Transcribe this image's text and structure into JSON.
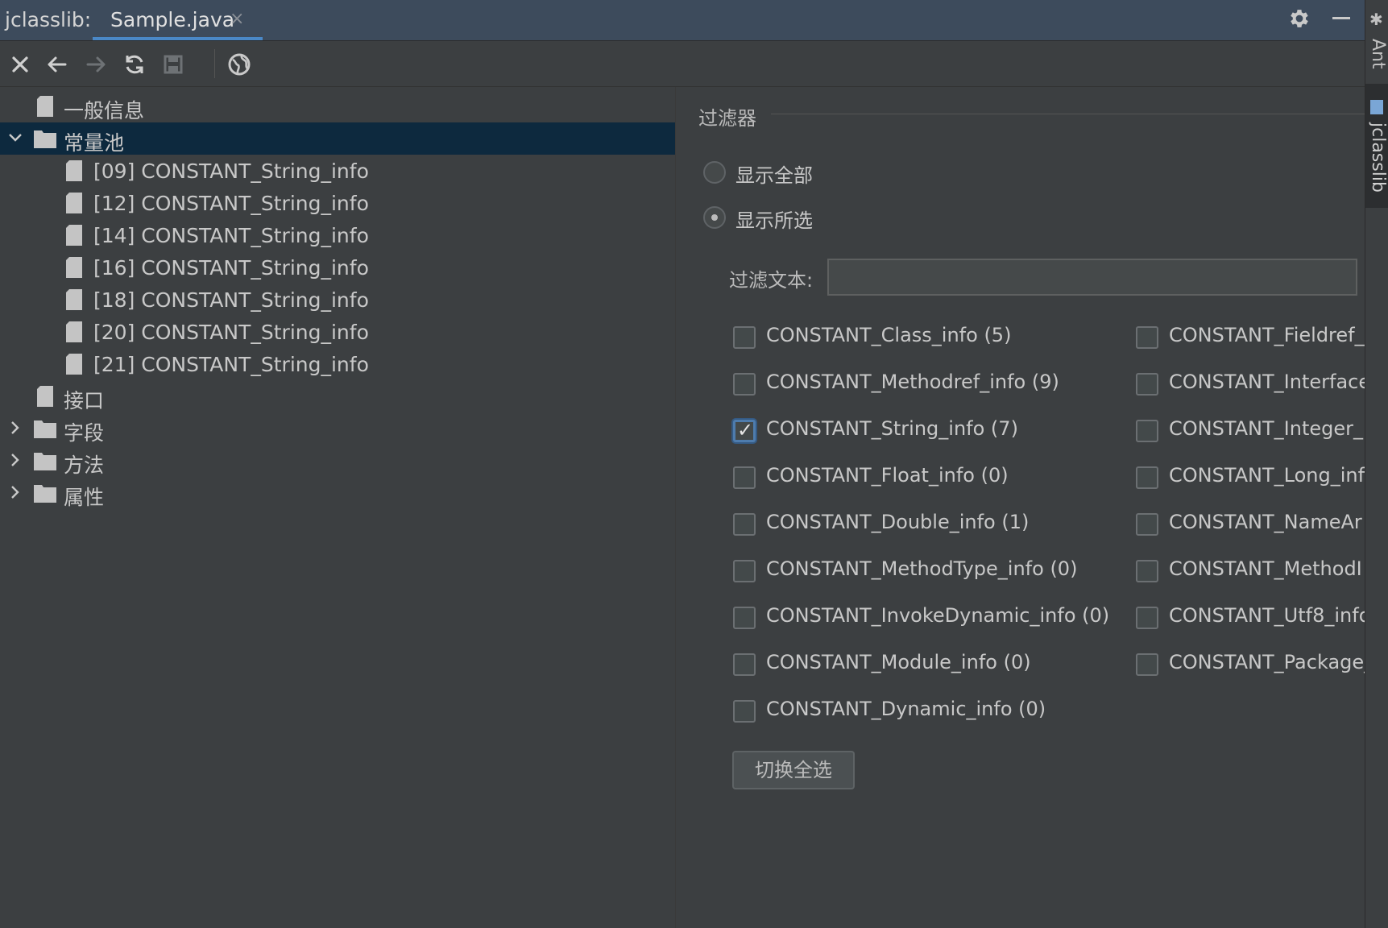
{
  "app": {
    "title": "jclasslib:"
  },
  "tab": {
    "label": "Sample.java",
    "close": "×"
  },
  "tree": {
    "items": [
      {
        "label": "一般信息",
        "type": "file",
        "level": 0,
        "expand": "none"
      },
      {
        "label": "常量池",
        "type": "folder",
        "level": 0,
        "expand": "expanded",
        "selected": true
      },
      {
        "label": "[09] CONSTANT_String_info",
        "type": "file",
        "level": 1
      },
      {
        "label": "[12] CONSTANT_String_info",
        "type": "file",
        "level": 1
      },
      {
        "label": "[14] CONSTANT_String_info",
        "type": "file",
        "level": 1
      },
      {
        "label": "[16] CONSTANT_String_info",
        "type": "file",
        "level": 1
      },
      {
        "label": "[18] CONSTANT_String_info",
        "type": "file",
        "level": 1
      },
      {
        "label": "[20] CONSTANT_String_info",
        "type": "file",
        "level": 1
      },
      {
        "label": "[21] CONSTANT_String_info",
        "type": "file",
        "level": 1
      },
      {
        "label": "接口",
        "type": "file",
        "level": 0,
        "expand": "none"
      },
      {
        "label": "字段",
        "type": "folder",
        "level": 0,
        "expand": "collapsed"
      },
      {
        "label": "方法",
        "type": "folder",
        "level": 0,
        "expand": "collapsed"
      },
      {
        "label": "属性",
        "type": "folder",
        "level": 0,
        "expand": "collapsed"
      }
    ]
  },
  "filter": {
    "title": "过滤器",
    "radio_all": "显示全部",
    "radio_selected": "显示所选",
    "selected_radio": "radio_selected",
    "text_label": "过滤文本:",
    "text_value": "",
    "col1": [
      {
        "label": "CONSTANT_Class_info (5)",
        "checked": false
      },
      {
        "label": "CONSTANT_Methodref_info (9)",
        "checked": false
      },
      {
        "label": "CONSTANT_String_info (7)",
        "checked": true
      },
      {
        "label": "CONSTANT_Float_info (0)",
        "checked": false
      },
      {
        "label": "CONSTANT_Double_info (1)",
        "checked": false
      },
      {
        "label": "CONSTANT_MethodType_info (0)",
        "checked": false
      },
      {
        "label": "CONSTANT_InvokeDynamic_info (0)",
        "checked": false
      },
      {
        "label": "CONSTANT_Module_info (0)",
        "checked": false
      },
      {
        "label": "CONSTANT_Dynamic_info (0)",
        "checked": false
      }
    ],
    "col2": [
      {
        "label": "CONSTANT_Fieldref_",
        "checked": false
      },
      {
        "label": "CONSTANT_Interface",
        "checked": false
      },
      {
        "label": "CONSTANT_Integer_",
        "checked": false
      },
      {
        "label": "CONSTANT_Long_inf",
        "checked": false
      },
      {
        "label": "CONSTANT_NameAr",
        "checked": false
      },
      {
        "label": "CONSTANT_MethodI",
        "checked": false
      },
      {
        "label": "CONSTANT_Utf8_info",
        "checked": false
      },
      {
        "label": "CONSTANT_Package_",
        "checked": false
      }
    ],
    "toggle_button": "切换全选",
    "check_mark": "✓"
  },
  "sidebar": {
    "ant_label": "Ant",
    "jclasslib_label": "jclasslib"
  },
  "colors": {
    "selection": "#0d293e",
    "accent": "#4a88c7"
  }
}
